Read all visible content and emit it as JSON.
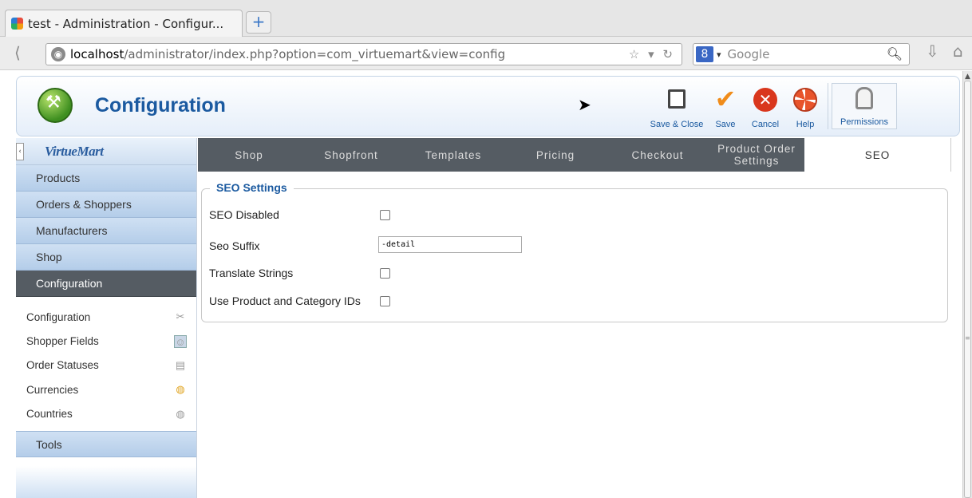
{
  "browser": {
    "tab_title": "test - Administration - Configur...",
    "new_tab_label": "+",
    "url_host": "localhost",
    "url_path": "/administrator/index.php?option=com_virtuemart&view=config",
    "search_engine": "8",
    "search_placeholder": "Google"
  },
  "header": {
    "title": "Configuration",
    "toolbar": {
      "save_close": "Save & Close",
      "save": "Save",
      "cancel": "Cancel",
      "help": "Help",
      "permissions": "Permissions"
    }
  },
  "sidebar": {
    "brand": "VirtueMart",
    "menu": [
      {
        "label": "Products"
      },
      {
        "label": "Orders & Shoppers"
      },
      {
        "label": "Manufacturers"
      },
      {
        "label": "Shop"
      },
      {
        "label": "Configuration",
        "active": true
      }
    ],
    "submenu": [
      {
        "label": "Configuration",
        "icon": "tools-icon"
      },
      {
        "label": "Shopper Fields",
        "icon": "user-card-icon"
      },
      {
        "label": "Order Statuses",
        "icon": "document-icon"
      },
      {
        "label": "Currencies",
        "icon": "coins-icon"
      },
      {
        "label": "Countries",
        "icon": "globe-icon"
      }
    ],
    "tools": "Tools"
  },
  "tabs": [
    {
      "label": "Shop"
    },
    {
      "label": "Shopfront"
    },
    {
      "label": "Templates"
    },
    {
      "label": "Pricing"
    },
    {
      "label": "Checkout"
    },
    {
      "label": "Product Order Settings"
    },
    {
      "label": "SEO",
      "active": true
    }
  ],
  "seo": {
    "legend": "SEO Settings",
    "seo_disabled_label": "SEO Disabled",
    "seo_disabled_checked": false,
    "seo_suffix_label": "Seo Suffix",
    "seo_suffix_value": "-detail",
    "translate_strings_label": "Translate Strings",
    "translate_strings_checked": false,
    "use_ids_label": "Use Product and Category IDs",
    "use_ids_checked": false
  },
  "colors": {
    "accent": "#1b5aa0",
    "active_menu": "#555c63",
    "menu_bg": "#b4cde9"
  }
}
